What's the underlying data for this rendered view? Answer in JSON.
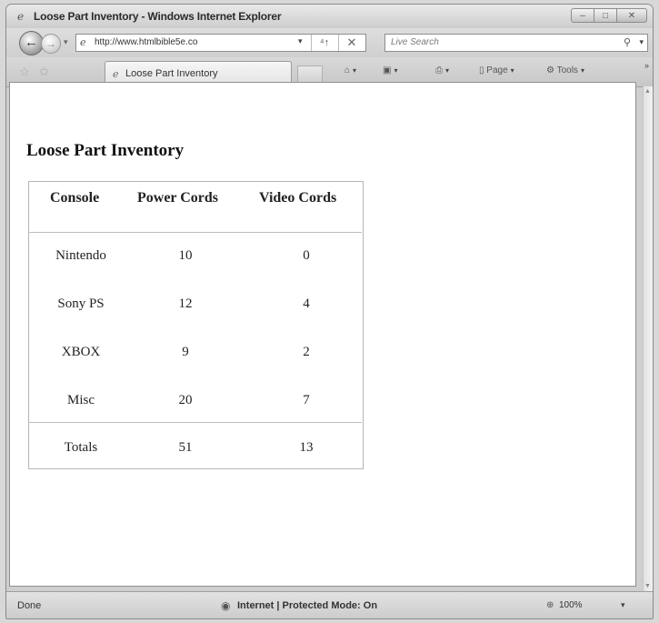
{
  "window": {
    "title": "Loose Part Inventory - Windows Internet Explorer",
    "controls": {
      "minimize": "–",
      "maximize": "□",
      "close": "✕"
    }
  },
  "address_bar": {
    "url": "http://www.htmlbible5e.co",
    "dropdown": "▾",
    "refresh": "⁴↑",
    "stop": "✕"
  },
  "search": {
    "placeholder": "Live Search",
    "dropdown": "▾"
  },
  "tab": {
    "label": "Loose Part Inventory"
  },
  "command_bar": {
    "page_label": "Page",
    "tools_label": "Tools",
    "overflow": "»"
  },
  "page": {
    "heading": "Loose Part Inventory",
    "table": {
      "headers": [
        "Console",
        "Power Cords",
        "Video Cords"
      ],
      "rows": [
        [
          "Nintendo",
          "10",
          "0"
        ],
        [
          "Sony PS",
          "12",
          "4"
        ],
        [
          "XBOX",
          "9",
          "2"
        ],
        [
          "Misc",
          "20",
          "7"
        ]
      ],
      "totals": [
        "Totals",
        "51",
        "13"
      ]
    }
  },
  "status_bar": {
    "left": "Done",
    "zone": "Internet | Protected Mode: On",
    "zoom": "100%"
  },
  "icons": {
    "back": "back-arrow-icon",
    "forward": "forward-arrow-icon",
    "page": "page-icon",
    "favorites": "star-icon",
    "add_favorites": "add-favorites-icon",
    "home": "home-icon",
    "feeds": "feeds-icon",
    "print": "printer-icon",
    "globe": "globe-icon",
    "search": "search-icon"
  }
}
